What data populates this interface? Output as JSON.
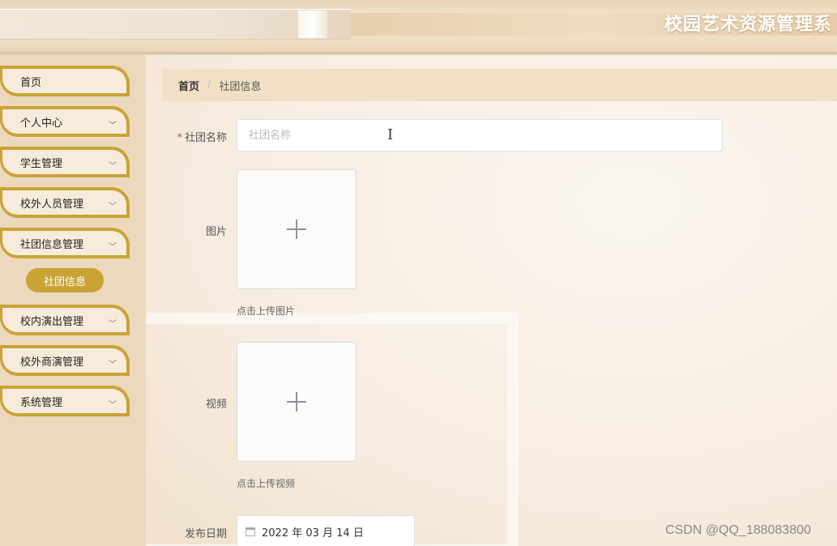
{
  "header": {
    "title": "校园艺术资源管理系"
  },
  "sidebar": {
    "items": [
      {
        "label": "首页",
        "has_chevron": false
      },
      {
        "label": "个人中心",
        "has_chevron": true
      },
      {
        "label": "学生管理",
        "has_chevron": true
      },
      {
        "label": "校外人员管理",
        "has_chevron": true
      },
      {
        "label": "社团信息管理",
        "has_chevron": true
      },
      {
        "label": "校内演出管理",
        "has_chevron": true
      },
      {
        "label": "校外商演管理",
        "has_chevron": true
      },
      {
        "label": "系统管理",
        "has_chevron": true
      }
    ],
    "active_sub_item": "社团信息",
    "chevron_glyph": "﹀"
  },
  "breadcrumb": {
    "home": "首页",
    "separator": "/",
    "current": "社团信息"
  },
  "form": {
    "club_name": {
      "required_mark": "*",
      "label": "社团名称",
      "placeholder": "社团名称",
      "value": ""
    },
    "image": {
      "label": "图片",
      "tip": "点击上传图片"
    },
    "video": {
      "label": "视频",
      "tip": "点击上传视频"
    },
    "publish_date": {
      "label": "发布日期",
      "value": "2022 年 03 月 14 日"
    }
  },
  "watermark": "CSDN @QQ_188083800",
  "colors": {
    "accent": "#c9a335",
    "required": "#e04b4b"
  }
}
